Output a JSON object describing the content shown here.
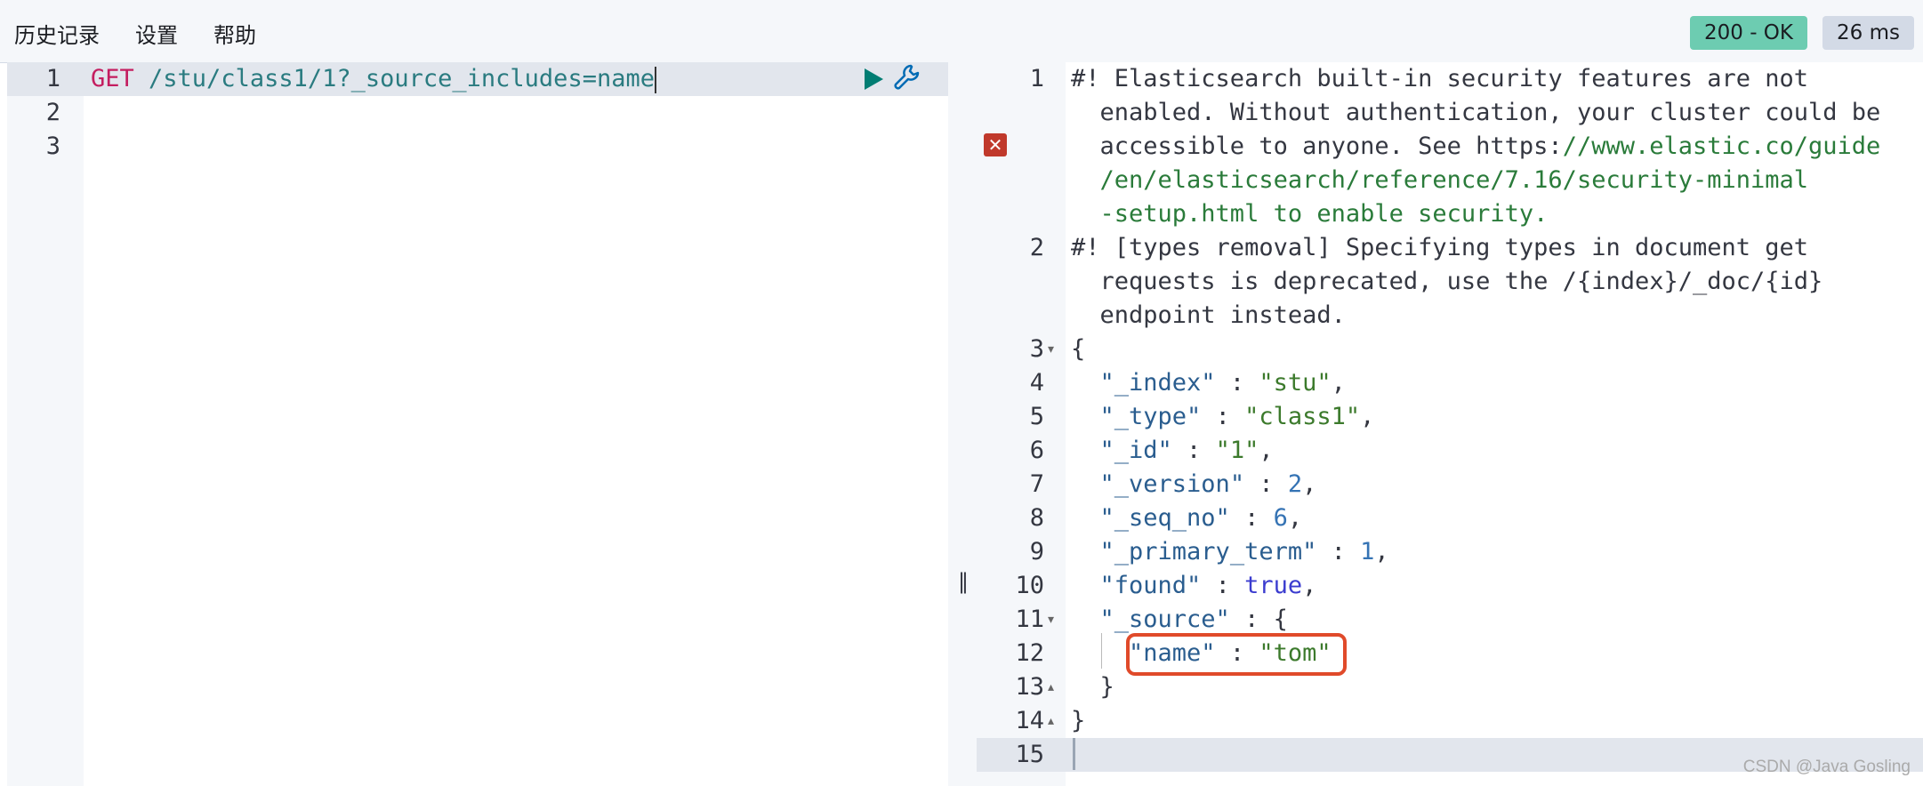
{
  "menu": {
    "history": "历史记录",
    "settings": "设置",
    "help": "帮助"
  },
  "status": {
    "code": "200 - OK",
    "timing": "26 ms"
  },
  "editor": {
    "line_numbers": [
      "1",
      "2",
      "3"
    ],
    "request_method": "GET",
    "request_path": " /stu/class1/1?_source_includes=name"
  },
  "output": {
    "line_numbers": [
      "1",
      "2",
      "3",
      "4",
      "5",
      "6",
      "7",
      "8",
      "9",
      "10",
      "11",
      "12",
      "13",
      "14",
      "15"
    ],
    "warning1": {
      "l1": "#! Elasticsearch built-in security features are not",
      "l2": "  enabled. Without authentication, your cluster could be",
      "l3a": "  accessible to anyone. See https:",
      "l3b": "//www.elastic.co/guide",
      "l4": "  /en/elasticsearch/reference/7.16/security-minimal",
      "l5": "  -setup.html to enable security."
    },
    "warning2": {
      "l1": "#! [types removal] Specifying types in document get",
      "l2": "  requests is deprecated, use the /{index}/_doc/{id}",
      "l3": "  endpoint instead."
    },
    "json": {
      "open": "{",
      "index_key": "\"_index\"",
      "index_val": "\"stu\"",
      "type_key": "\"_type\"",
      "type_val": "\"class1\"",
      "id_key": "\"_id\"",
      "id_val": "\"1\"",
      "version_key": "\"_version\"",
      "version_val": "2",
      "seq_key": "\"_seq_no\"",
      "seq_val": "6",
      "term_key": "\"_primary_term\"",
      "term_val": "1",
      "found_key": "\"found\"",
      "found_val": "true",
      "source_key": "\"_source\"",
      "source_open": "{",
      "name_key": "\"name\"",
      "name_val": "\"tom\"",
      "source_close": "}",
      "close": "}"
    }
  },
  "watermark": "CSDN @Java Gosling",
  "colors": {
    "status_ok": "#6dccb1",
    "highlight_border": "#e04a2a",
    "method": "#c41e60"
  }
}
